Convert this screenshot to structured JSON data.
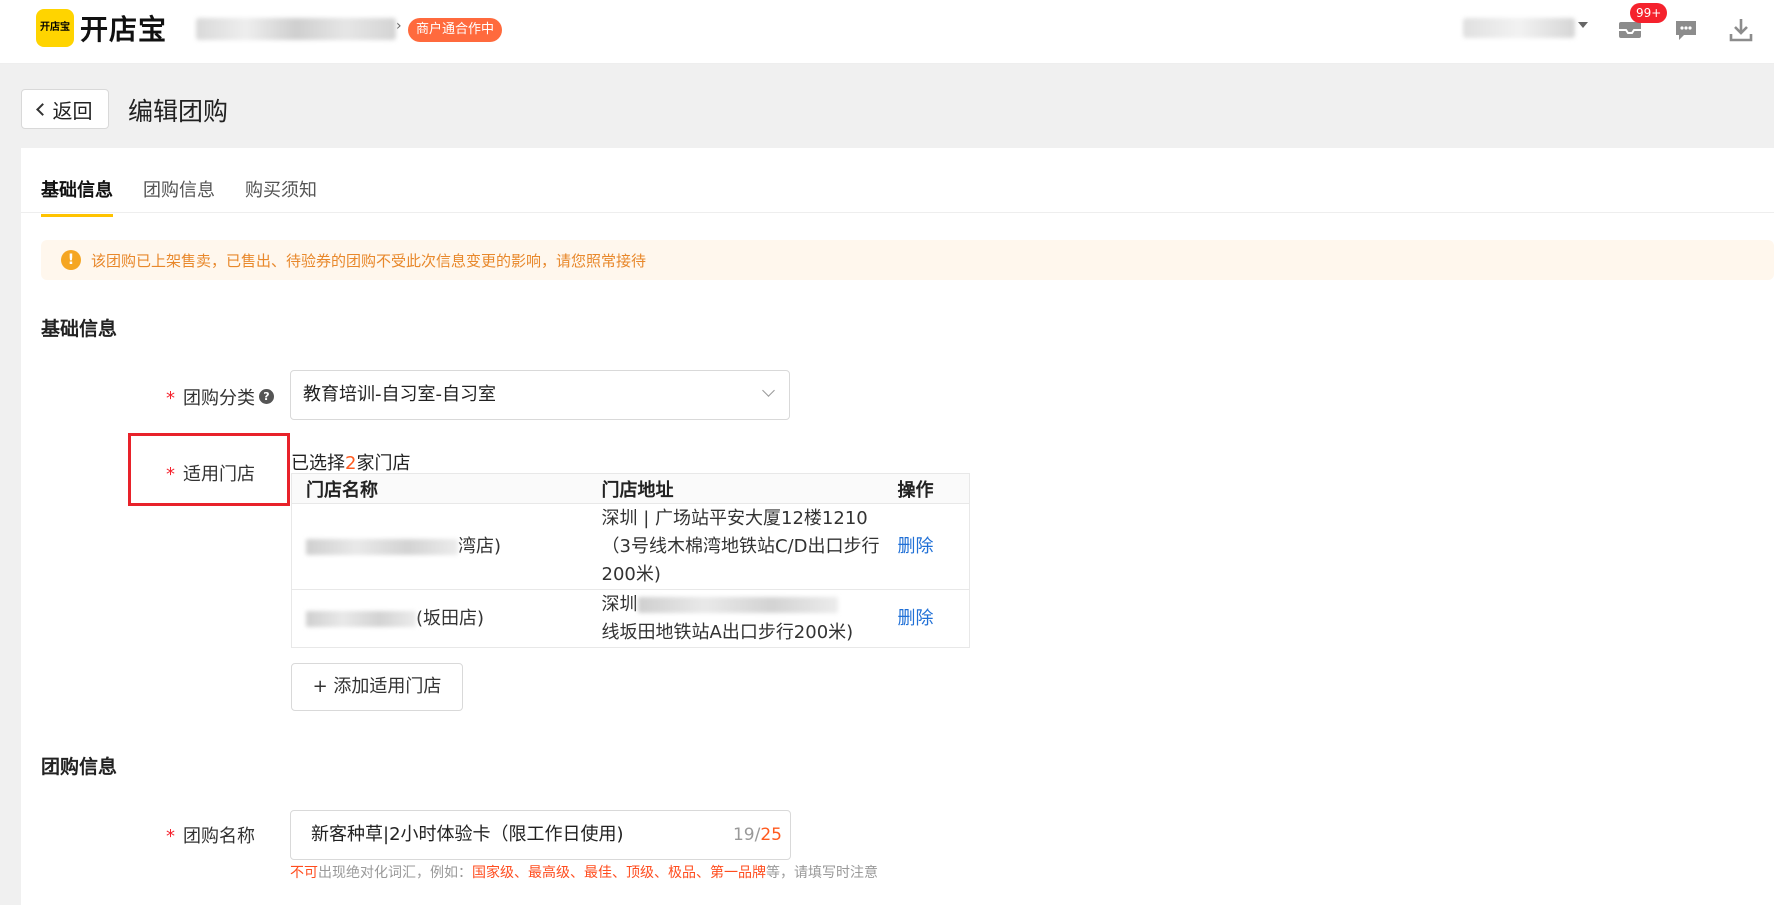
{
  "topbar": {
    "logo_mark": "开店宝",
    "logo_text": "开店宝",
    "coop_badge": "商户通合作中",
    "notif_count": "99+"
  },
  "header": {
    "back_label": "返回",
    "title": "编辑团购"
  },
  "tabs": [
    {
      "label": "基础信息",
      "active": true
    },
    {
      "label": "团购信息",
      "active": false
    },
    {
      "label": "购买须知",
      "active": false
    }
  ],
  "alert": {
    "icon": "!",
    "text": "该团购已上架售卖，已售出、待验券的团购不受此次信息变更的影响，请您照常接待"
  },
  "basic_section": {
    "title": "基础信息",
    "category_label": "团购分类",
    "category_help": "?",
    "category_value": "教育培训-自习室-自习室",
    "stores_label": "适用门店",
    "selected_prefix": "已选择",
    "selected_count": "2",
    "selected_suffix": "家门店",
    "table_headers": [
      "门店名称",
      "门店地址",
      "操作"
    ],
    "rows": [
      {
        "name_visible": "湾店)",
        "address_line1": "深圳 | 广场站平安大厦12楼1210",
        "address_line2": "（3号线木棉湾地铁站C/D出口步行",
        "address_line3": "200米)",
        "action": "删除"
      },
      {
        "name_visible": "(坂田店)",
        "address_line1": "深圳",
        "address_line2": "线坂田地铁站A出口步行200米)",
        "action": "删除"
      }
    ],
    "add_store_button": "+ 添加适用门店"
  },
  "deal_section": {
    "title": "团购信息",
    "name_label": "团购名称",
    "name_value": "新客种草|2小时体验卡（限工作日使用)",
    "char_count": "19",
    "char_sep": "/",
    "char_max": "25",
    "hint_prefix": "不可",
    "hint_mid": "出现绝对化词汇，例如：",
    "hint_words": "国家级、最高级、最佳、顶级、极品、第一品牌",
    "hint_suffix": "等，请填写时注意"
  },
  "colors": {
    "accent": "#ffc300",
    "brand": "#ffd400",
    "danger": "#f5222d",
    "link": "#1f6fd6",
    "highlight": "#ff5a1f"
  }
}
